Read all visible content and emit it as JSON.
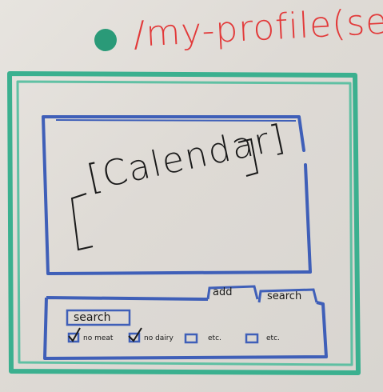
{
  "title": "/my-profile(se",
  "calendar": {
    "label": "[Calendar]"
  },
  "tabs": [
    {
      "label": "add"
    },
    {
      "label": "search"
    }
  ],
  "search_button": {
    "label": "search"
  },
  "filters": [
    {
      "label": "no meat",
      "checked": true
    },
    {
      "label": "no dairy",
      "checked": true
    },
    {
      "label": "etc.",
      "checked": false
    },
    {
      "label": "etc.",
      "checked": false
    }
  ],
  "colors": {
    "whiteboard": "#e0ddd8",
    "frame": "#3bb08f",
    "sketch": "#3f5fb8",
    "ink": "#1a1a1a",
    "title": "#e23a3a",
    "bullet": "#2a9a78"
  }
}
